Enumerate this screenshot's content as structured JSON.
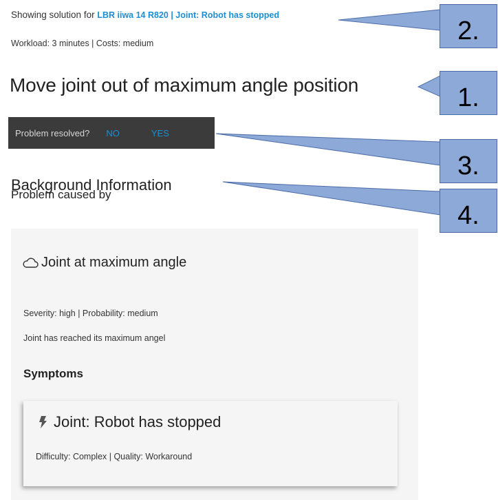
{
  "header": {
    "showing_prefix": "Showing solution for",
    "showing_link": "LBR iiwa 14 R820 | Joint: Robot has stopped",
    "workload": "Workload: 3 minutes | Costs: medium"
  },
  "solution": {
    "title": "Move joint out of maximum angle position"
  },
  "resolved_bar": {
    "question": "Problem resolved?",
    "no_label": "NO",
    "yes_label": "YES"
  },
  "background": {
    "heading": "Background Information",
    "caused_by": "Problem caused by"
  },
  "cause": {
    "title": "Joint at maximum angle",
    "meta": "Severity: high | Probability: medium",
    "description": "Joint has reached its maximum angel",
    "symptoms_heading": "Symptoms"
  },
  "symptom": {
    "title": "Joint: Robot has stopped",
    "meta": "Difficulty: Complex | Quality: Workaround"
  },
  "callouts": [
    "2.",
    "1.",
    "3.",
    "4."
  ],
  "colors": {
    "link": "#1a8fd6",
    "bar": "#3b3b3b",
    "card": "#f5f5f5",
    "callout_fill": "#8da9d8",
    "callout_border": "#4a6aa8"
  }
}
